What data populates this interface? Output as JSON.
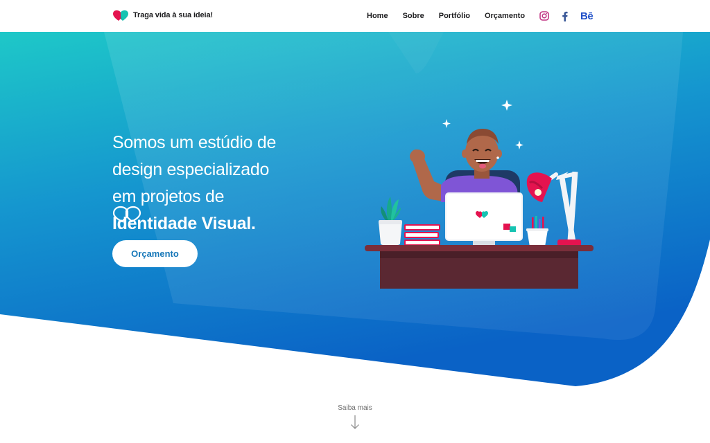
{
  "brand": {
    "tagline": "Traga vida à sua ideia!"
  },
  "nav": {
    "items": [
      "Home",
      "Sobre",
      "Portfólio",
      "Orçamento"
    ]
  },
  "social": {
    "icons": [
      "instagram-icon",
      "facebook-icon",
      "behance-icon"
    ],
    "behance_text": "Bē"
  },
  "hero": {
    "lines": [
      "Somos um estúdio de",
      "design especializado",
      "em projetos de",
      "Identidade Visual."
    ],
    "cta_label": "Orçamento"
  },
  "scroll": {
    "label": "Saiba mais"
  },
  "colors": {
    "accent": "#1677b8",
    "brand_pink": "#e4134f",
    "brand_teal": "#17c3b2",
    "gradient_top": "#1ec8c8",
    "gradient_bottom": "#0a66c8"
  }
}
